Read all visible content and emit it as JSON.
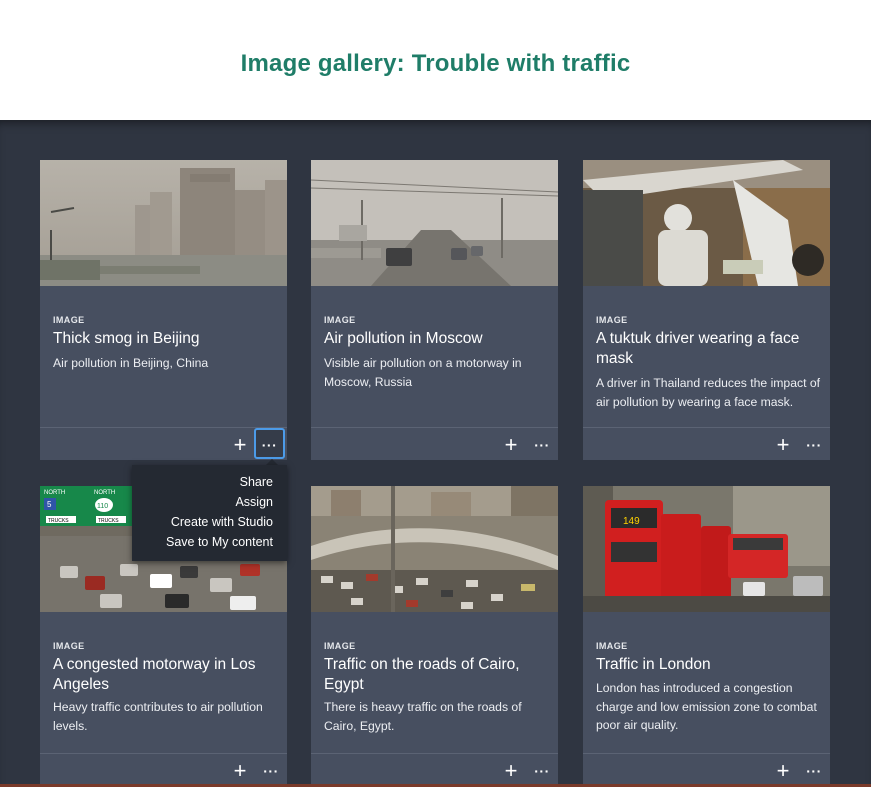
{
  "page": {
    "title": "Image gallery: Trouble with traffic"
  },
  "cards": [
    {
      "type": "IMAGE",
      "title": "Thick smog in Beijing",
      "description": "Air pollution in Beijing, China",
      "image": "beijing-smog-photo"
    },
    {
      "type": "IMAGE",
      "title": "Air pollution in Moscow",
      "description": "Visible air pollution on a motorway in Moscow, Russia",
      "image": "moscow-motorway-photo"
    },
    {
      "type": "IMAGE",
      "title": "A tuktuk driver wearing a face mask",
      "description": "A driver in Thailand reduces the impact of air pollution by wearing a face mask.",
      "image": "tuktuk-driver-photo"
    },
    {
      "type": "IMAGE",
      "title": "A congested motorway in Los Angeles",
      "description": "Heavy traffic contributes to air pollution levels.",
      "image": "los-angeles-traffic-photo"
    },
    {
      "type": "IMAGE",
      "title": "Traffic on the roads of Cairo, Egypt",
      "description": "There is heavy traffic on the roads of Cairo, Egypt.",
      "image": "cairo-traffic-photo"
    },
    {
      "type": "IMAGE",
      "title": "Traffic in London",
      "description": "London has introduced a congestion charge and low emission zone to combat poor air quality.",
      "image": "london-buses-photo"
    }
  ],
  "card_actions": {
    "add_symbol": "+",
    "more_symbol": "···"
  },
  "menu": {
    "items": [
      "Share",
      "Assign",
      "Create with Studio",
      "Save to My content"
    ]
  },
  "image_signs": {
    "north": "NORTH",
    "route_5": "5",
    "route_110": "110",
    "trucks": "TRUCKS",
    "bus_route": "149"
  },
  "colors": {
    "title_green": "#1f7d68",
    "gallery_bg": "#2f3541",
    "card_bg": "#474f60",
    "focus_ring": "#4c9be8"
  }
}
